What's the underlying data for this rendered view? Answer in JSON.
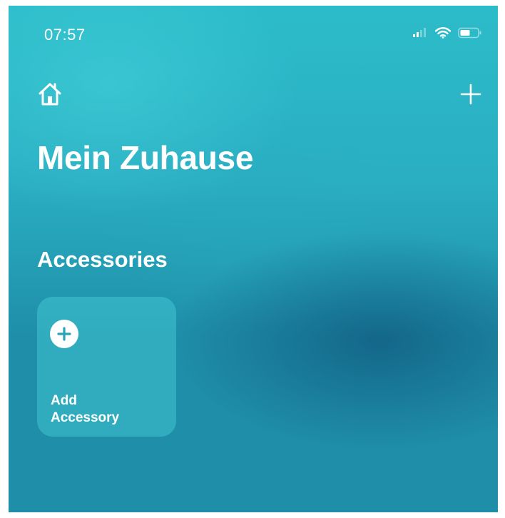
{
  "status_bar": {
    "time": "07:57",
    "icons": [
      "cellular-signal-icon",
      "wifi-icon",
      "battery-icon"
    ]
  },
  "nav": {
    "home_icon": "home-icon",
    "add_icon": "plus-icon"
  },
  "page": {
    "title": "Mein Zuhause"
  },
  "accessories": {
    "section_title": "Accessories",
    "add_tile": {
      "icon": "plus-circle-icon",
      "label_line1": "Add",
      "label_line2": "Accessory"
    }
  },
  "colors": {
    "background_top": "#2cbcc9",
    "background_bottom": "#1f8ea8",
    "text": "#ffffff",
    "tile": "#50dce1"
  }
}
